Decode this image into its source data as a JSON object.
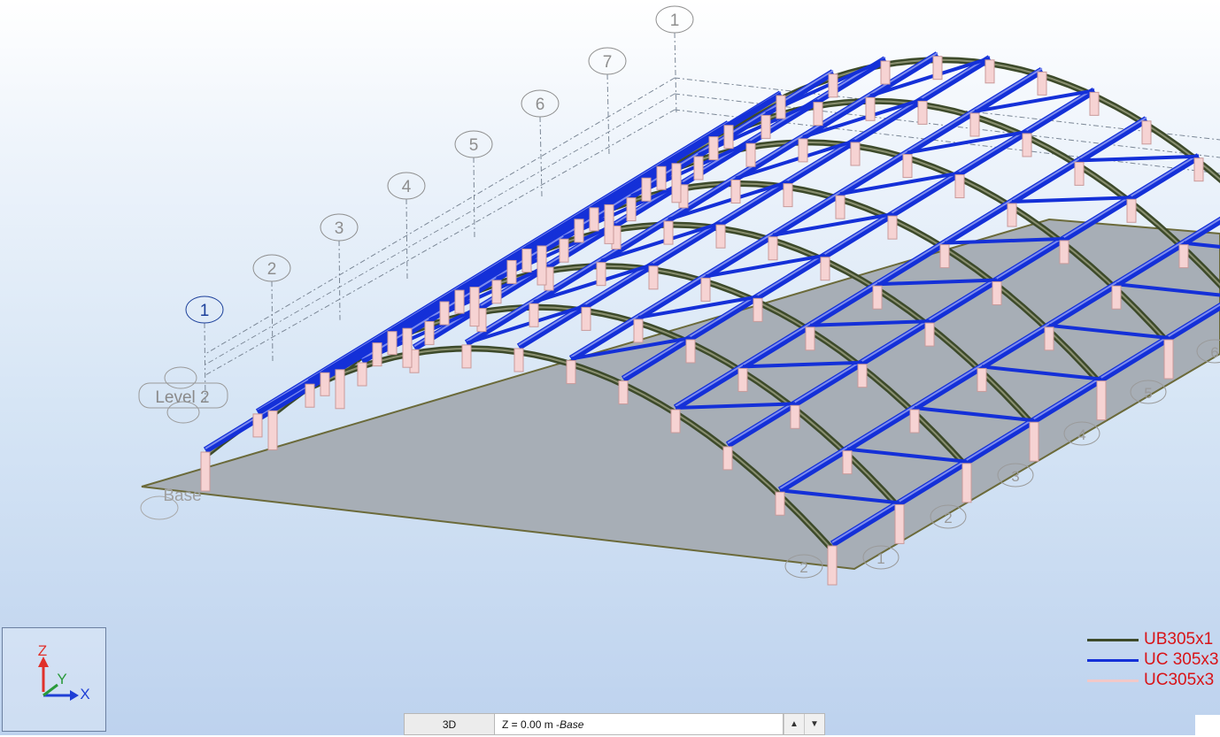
{
  "grid_bubbles_back": [
    "1",
    "7",
    "6",
    "5",
    "4",
    "3",
    "2"
  ],
  "grid_bubble_selected": "1",
  "grid_bubbles_front": [
    "1",
    "2",
    "3",
    "4",
    "5",
    "6"
  ],
  "grid_bubbles_side": [
    "2",
    "3",
    "2",
    "1"
  ],
  "levels": {
    "upper": "Level 2",
    "base": "Base"
  },
  "axis": {
    "z": "Z",
    "y": "Y",
    "x": "X"
  },
  "legend": [
    {
      "label": "UB305x1",
      "color": "#3d4a2a"
    },
    {
      "label": "UC 305x3",
      "color": "#1430d8"
    },
    {
      "label": "UC305x3",
      "color": "#f2c8c8"
    }
  ],
  "view_bar": {
    "tab": "3D",
    "level_prefix": "Z = 0.00 m - ",
    "level_name": "Base",
    "up_icon": "▲",
    "down_icon": "▼"
  }
}
